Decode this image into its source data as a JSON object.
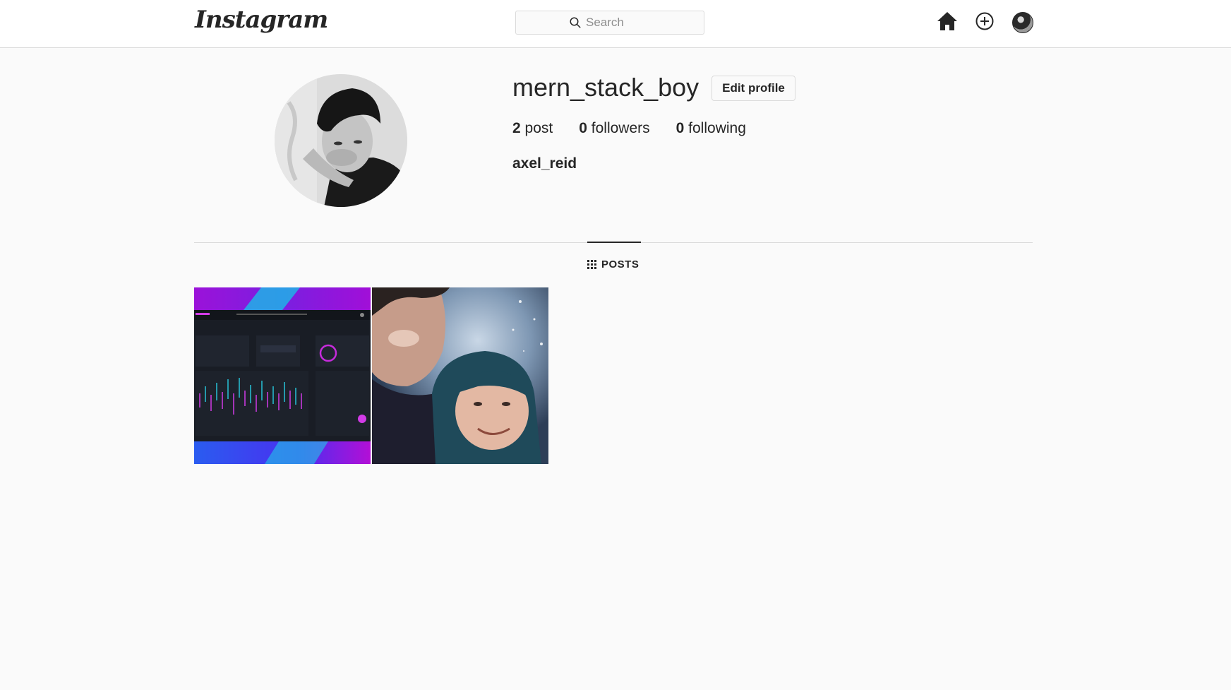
{
  "header": {
    "logo_text": "Instagram",
    "search": {
      "placeholder": "Search"
    },
    "icons": [
      "home-icon",
      "add-post-icon",
      "profile-avatar"
    ]
  },
  "profile": {
    "username": "mern_stack_boy",
    "edit_label": "Edit profile",
    "stats": {
      "posts_count": "2",
      "posts_label": "post",
      "followers_count": "0",
      "followers_label": "followers",
      "following_count": "0",
      "following_label": "following"
    },
    "full_name": "axel_reid"
  },
  "tabs": {
    "posts_label": "POSTS"
  },
  "posts": [
    {
      "kind": "dashboard-screenshot"
    },
    {
      "kind": "selfie-photo"
    }
  ]
}
